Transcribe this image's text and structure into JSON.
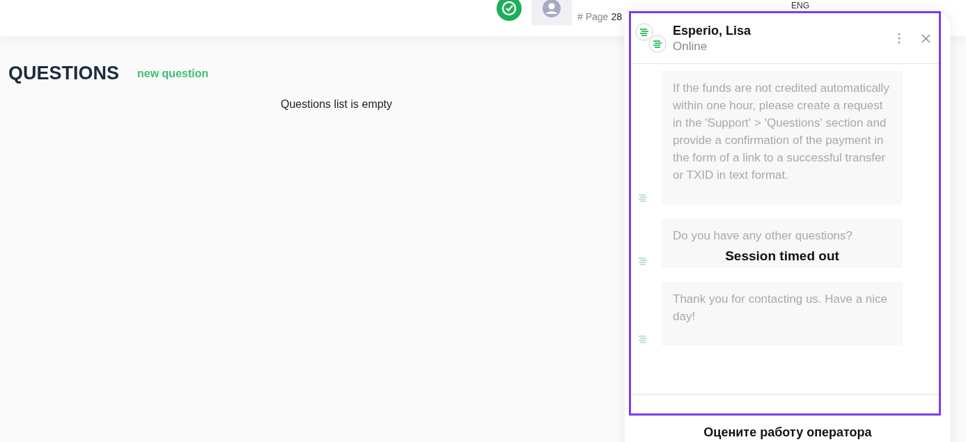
{
  "topbar": {
    "page_label": "# Page",
    "page_number": "28",
    "language": "ENG"
  },
  "questions": {
    "title": "QUESTIONS",
    "new_link": "new question",
    "empty_text": "Questions list is empty"
  },
  "chat": {
    "operator_name": "Esperio, Lisa",
    "status": "Online",
    "overlay_text": "Session timed out",
    "messages": [
      {
        "text": "If the funds are not credited automatically within one hour, please create a request in the 'Support' > 'Questions' section and provide a confirmation of the payment in the form of a link to a successful transfer or TXID in text format."
      },
      {
        "text": "Do you have any other questions?"
      },
      {
        "text": "Thank you for contacting us. Have a nice day!"
      }
    ],
    "rating_prompt": "Оцените работу оператора"
  }
}
